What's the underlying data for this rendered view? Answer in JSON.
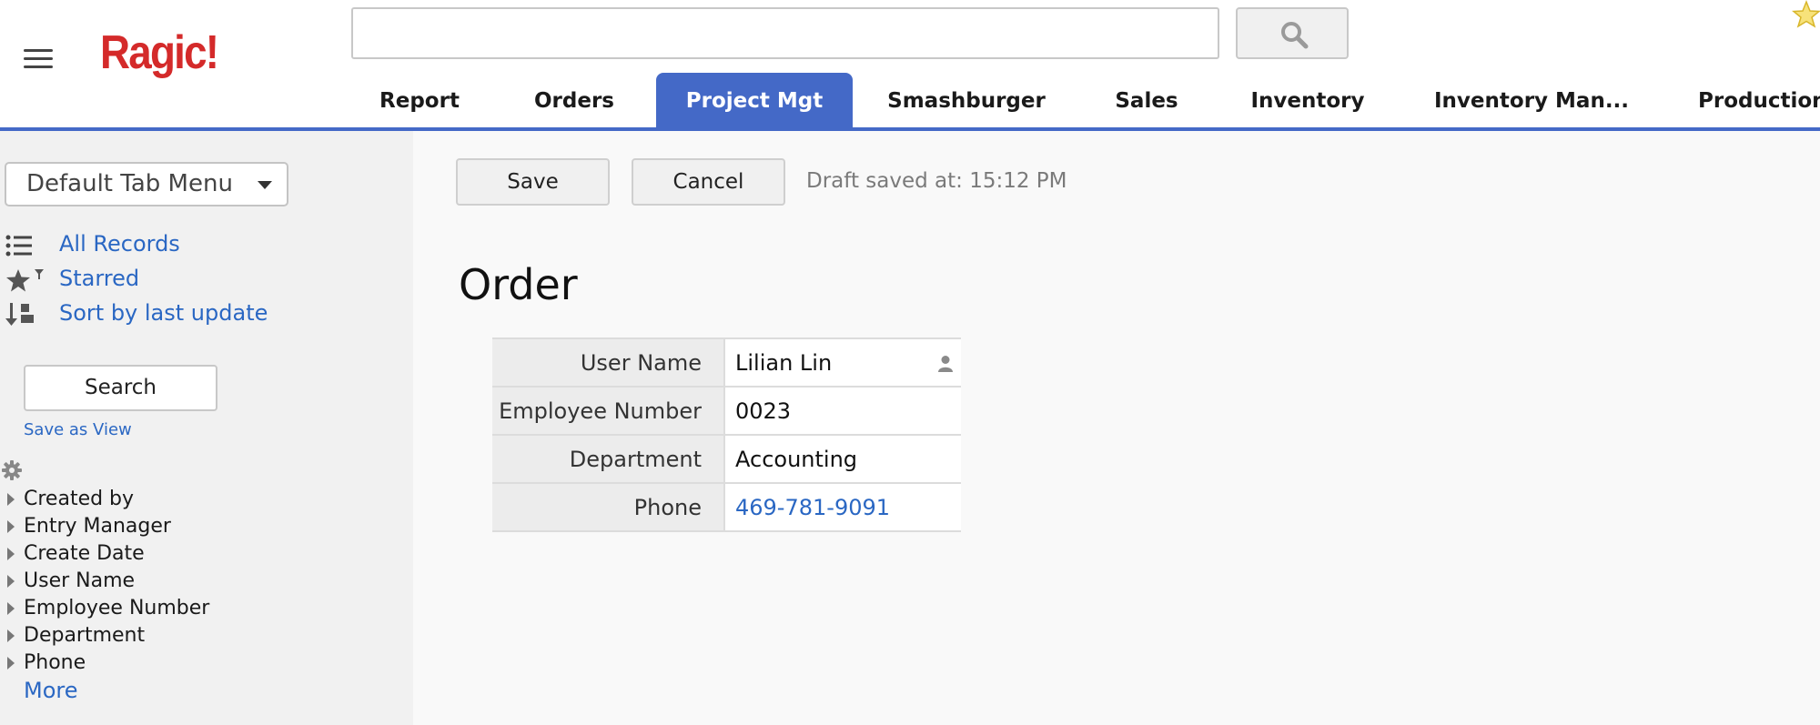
{
  "header": {
    "logo": "Ragic!",
    "search": {
      "value": "",
      "placeholder": ""
    },
    "tabs": [
      {
        "label": "Report",
        "active": false
      },
      {
        "label": "Orders",
        "active": false
      },
      {
        "label": "Project Mgt",
        "active": true
      },
      {
        "label": "Smashburger",
        "active": false
      },
      {
        "label": "Sales",
        "active": false
      },
      {
        "label": "Inventory",
        "active": false
      },
      {
        "label": "Inventory Man...",
        "active": false
      },
      {
        "label": "Production",
        "active": false
      }
    ],
    "icons": [
      "hamburger-menu-icon",
      "search-icon",
      "star-icon"
    ]
  },
  "sidebar": {
    "tab_menu": "Default Tab Menu",
    "links": [
      {
        "label": "All Records",
        "icon": "list-icon"
      },
      {
        "label": "Starred",
        "icon": "star-filter-icon"
      },
      {
        "label": "Sort by last update",
        "icon": "sort-icon"
      }
    ],
    "search_label": "Search",
    "save_view_label": "Save as View",
    "fields": [
      "Created by",
      "Entry Manager",
      "Create Date",
      "User Name",
      "Employee Number",
      "Department",
      "Phone"
    ],
    "more_label": "More"
  },
  "toolbar": {
    "save_label": "Save",
    "cancel_label": "Cancel",
    "draft_status": "Draft saved at: 15:12 PM"
  },
  "form": {
    "title": "Order",
    "rows": [
      {
        "label": "User Name",
        "value": "Lilian Lin"
      },
      {
        "label": "Employee Number",
        "value": "0023"
      },
      {
        "label": "Department",
        "value": "Accounting"
      },
      {
        "label": "Phone",
        "value": "469-781-9091"
      }
    ]
  },
  "colors": {
    "accent": "#4469c7",
    "link": "#2a67c3",
    "logo": "#d42a2a"
  }
}
